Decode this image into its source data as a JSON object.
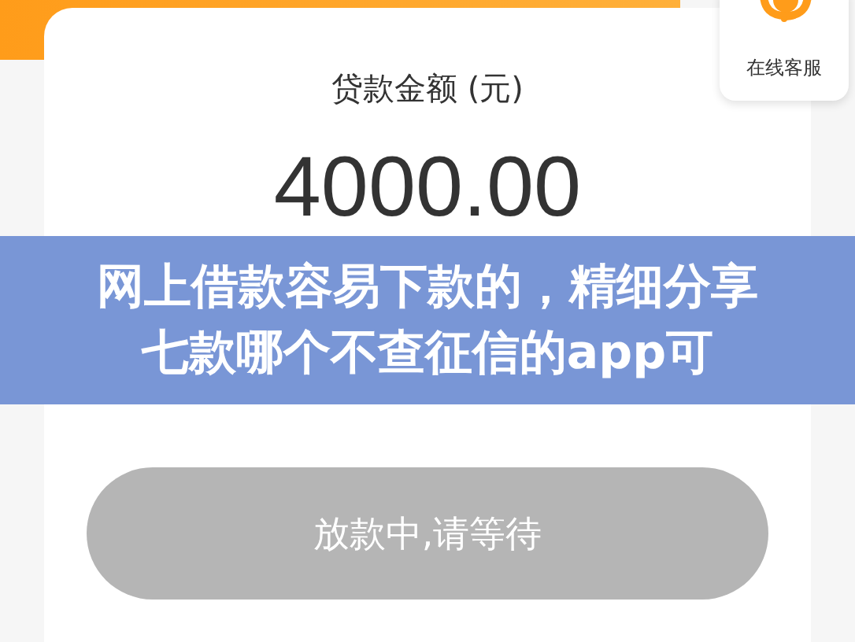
{
  "loan": {
    "label": "贷款金额 (元)",
    "amount": "4000.00"
  },
  "service": {
    "label": "在线客服"
  },
  "banner": {
    "title": "网上借款容易下款的，精细分享七款哪个不查征信的app可"
  },
  "action": {
    "label": "放款中,请等待",
    "disabled": true
  }
}
